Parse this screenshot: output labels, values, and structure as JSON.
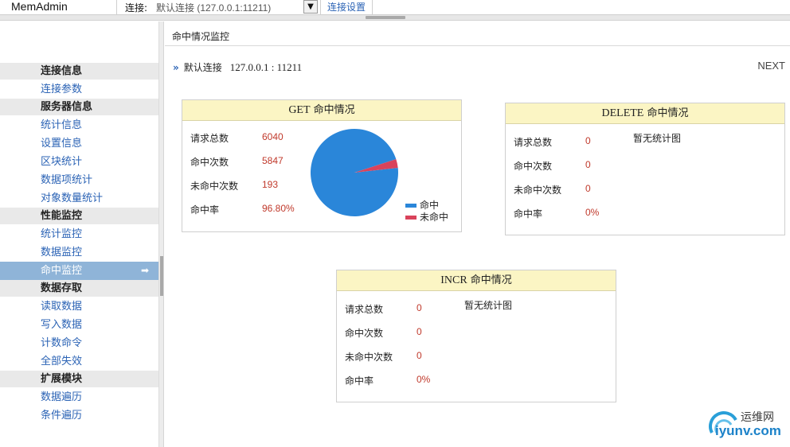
{
  "app": {
    "title": "MemAdmin"
  },
  "connection": {
    "label": "连接:",
    "value": "默认连接 (127.0.0.1:11211)",
    "dropdown_icon": "▼",
    "settings_label": "连接设置"
  },
  "sidebar": {
    "groups": [
      {
        "label": "连接信息",
        "items": [
          {
            "label": "连接参数"
          }
        ]
      },
      {
        "label": "服务器信息",
        "items": [
          {
            "label": "统计信息"
          },
          {
            "label": "设置信息"
          },
          {
            "label": "区块统计"
          },
          {
            "label": "数据项统计"
          },
          {
            "label": "对象数量统计"
          }
        ]
      },
      {
        "label": "性能监控",
        "items": [
          {
            "label": "统计监控"
          },
          {
            "label": "数据监控"
          },
          {
            "label": "命中监控",
            "active": true
          }
        ]
      },
      {
        "label": "数据存取",
        "items": [
          {
            "label": "读取数据"
          },
          {
            "label": "写入数据"
          },
          {
            "label": "计数命令"
          },
          {
            "label": "全部失效"
          }
        ]
      },
      {
        "label": "扩展模块",
        "items": [
          {
            "label": "数据遍历"
          },
          {
            "label": "条件遍历"
          }
        ]
      }
    ],
    "active_arrow": "➡"
  },
  "main": {
    "title": "命中情况监控",
    "connection_line": {
      "chevron": "»",
      "name": "默认连接",
      "address": "127.0.0.1 : 11211"
    },
    "next_label": "NEXT",
    "stat_labels": {
      "total": "请求总数",
      "hits": "命中次数",
      "misses": "未命中次数",
      "rate": "命中率"
    },
    "no_chart_text": "暂无统计图",
    "panels": {
      "get": {
        "title_en": "GET",
        "title_cn": " 命中情况",
        "total": "6040",
        "hits": "5847",
        "misses": "193",
        "rate": "96.80%",
        "legend": {
          "hit": "命中",
          "miss": "未命中"
        }
      },
      "delete": {
        "title_en": "DELETE",
        "title_cn": " 命中情况",
        "total": "0",
        "hits": "0",
        "misses": "0",
        "rate": "0%"
      },
      "incr": {
        "title_en": "INCR",
        "title_cn": " 命中情况",
        "total": "0",
        "hits": "0",
        "misses": "0",
        "rate": "0%"
      }
    }
  },
  "colors": {
    "hit": "#2a86d9",
    "miss": "#d9435b",
    "link": "#2b63b5",
    "value": "#c0392b",
    "panel_head": "#fbf5c4"
  },
  "chart_data": {
    "type": "pie",
    "title": "GET 命中情况",
    "categories": [
      "命中",
      "未命中"
    ],
    "values": [
      5847,
      193
    ]
  },
  "watermark": {
    "line1": "运维网",
    "line2": "iyunv.com"
  }
}
